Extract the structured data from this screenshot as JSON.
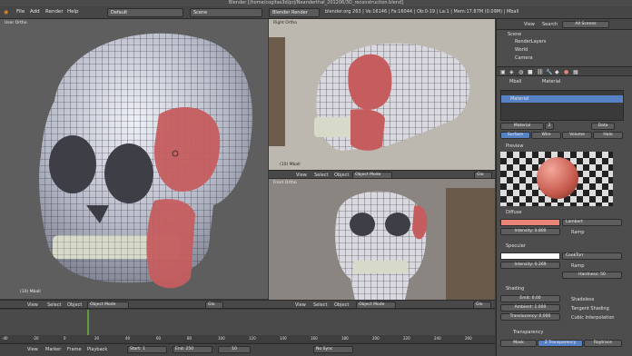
{
  "window_title": "Blender [/home/cogitas3d/prj/Neanderthal_201206/3D_reconstruction.blend]",
  "menu": [
    "File",
    "Add",
    "Render",
    "Help"
  ],
  "layout": "Default",
  "scene": "Scene",
  "engine": "Blender Render",
  "stats": "blender.org 263 | Ve:16146 | Fa:16044 | Ob:0-19 | La:1 | Mem:17.87M (0.09M) | Mball",
  "viewports": {
    "main": {
      "label": "User Ortho",
      "footer": "(10) Mball"
    },
    "right": {
      "label": "Right Ortho",
      "footer": "(10) Mball"
    },
    "front": {
      "label": "Front Ortho",
      "footer": "(10) Mball"
    }
  },
  "view_header": {
    "view": "View",
    "select": "Select",
    "object": "Object",
    "mode": "Object Mode",
    "pivot": "Glo"
  },
  "timeline": {
    "ticks": [
      "-40",
      "-20",
      "0",
      "20",
      "40",
      "60",
      "80",
      "100",
      "120",
      "140",
      "160",
      "180",
      "200",
      "220",
      "240",
      "260"
    ]
  },
  "bottom": {
    "view": "View",
    "marker": "Marker",
    "frame": "Frame",
    "playback": "Playback",
    "start": "Start: 1",
    "end": "End: 250",
    "current": "10",
    "sync": "No Sync"
  },
  "outliner": {
    "view": "View",
    "search": "Search",
    "scope": "All Scenes",
    "items": [
      "Scene",
      "RenderLayers",
      "World",
      "Camera"
    ]
  },
  "props": {
    "crumb": [
      "Mball",
      "Material"
    ],
    "material_slot": "Material",
    "material_name": "Material",
    "users": "2",
    "data_label": "Data",
    "tabs": [
      "Surface",
      "Wire",
      "Volume",
      "Halo"
    ],
    "preview": "Preview",
    "diffuse": {
      "title": "Diffuse",
      "shader": "Lambert",
      "intensity": "Intensity: 0.800",
      "ramp": "Ramp",
      "color": "#e98577"
    },
    "specular": {
      "title": "Specular",
      "shader": "CookTorr",
      "intensity": "Intensity: 0.269",
      "ramp": "Ramp",
      "hardness": "Hardness: 50"
    },
    "shading": {
      "title": "Shading",
      "emit": "Emit: 0.00",
      "ambient": "Ambient: 1.000",
      "translucency": "Translucency: 0.000",
      "shadeless": "Shadeless",
      "tangent": "Tangent Shading",
      "cubic": "Cubic Interpolation"
    },
    "transparency": {
      "title": "Transparency",
      "tabs": [
        "Mask",
        "Z Transparency",
        "Raytrace"
      ]
    }
  }
}
